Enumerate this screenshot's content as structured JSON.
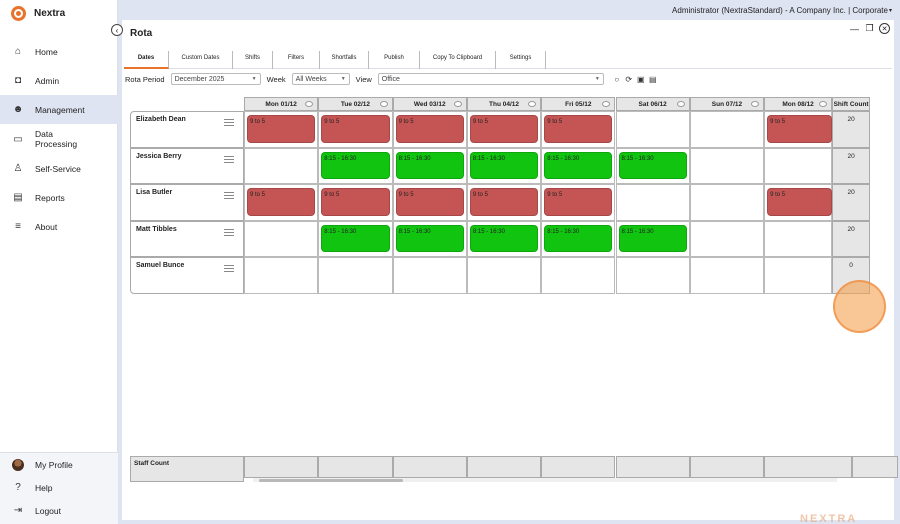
{
  "brand": {
    "name": "Nextra"
  },
  "topbar": {
    "user_text": "Administrator (NextraStandard) - A Company Inc. | Corporate"
  },
  "sidebar": {
    "items": [
      {
        "label": "Home",
        "icon": "home-icon",
        "glyph": "⌂"
      },
      {
        "label": "Admin",
        "icon": "camera-icon",
        "glyph": "◘"
      },
      {
        "label": "Management",
        "icon": "people-icon",
        "glyph": "☻"
      },
      {
        "label": "Data Processing",
        "icon": "folder-icon",
        "glyph": "▭"
      },
      {
        "label": "Self-Service",
        "icon": "person-icon",
        "glyph": "♙"
      },
      {
        "label": "Reports",
        "icon": "report-icon",
        "glyph": "▤"
      },
      {
        "label": "About",
        "icon": "menu-icon",
        "glyph": "≡"
      }
    ],
    "footer": [
      {
        "label": "My Profile",
        "icon": "avatar"
      },
      {
        "label": "Help",
        "icon": "help-icon",
        "glyph": "?"
      },
      {
        "label": "Logout",
        "icon": "logout-icon",
        "glyph": "⇥"
      }
    ]
  },
  "main": {
    "title": "Rota"
  },
  "tabs": [
    "Dates",
    "Custom Dates",
    "Shifts",
    "Filters",
    "Shortfalls",
    "Publish",
    "Copy To Clipboard",
    "Settings"
  ],
  "filters": {
    "rota_period_label": "Rota Period",
    "rota_period_value": "December 2025",
    "week_label": "Week",
    "week_value": "All Weeks",
    "view_label": "View",
    "view_value": "Office"
  },
  "grid": {
    "days": [
      "Mon 01/12",
      "Tue 02/12",
      "Wed 03/12",
      "Thu 04/12",
      "Fri 05/12",
      "Sat 06/12",
      "Sun 07/12",
      "Mon 08/12"
    ],
    "count_header": "Shift Count",
    "rows": [
      {
        "name": "Elizabeth Dean",
        "count": "20",
        "shifts": [
          "9 to 5",
          "9 to 5",
          "9 to 5",
          "9 to 5",
          "9 to 5",
          "",
          "",
          "9 to 5"
        ]
      },
      {
        "name": "Jessica Berry",
        "count": "20",
        "shifts": [
          "",
          "8:15 - 16:30",
          "8:15 - 16:30",
          "8:15 - 16:30",
          "8:15 - 16:30",
          "8:15 - 16:30",
          "",
          ""
        ]
      },
      {
        "name": "Lisa Butler",
        "count": "20",
        "shifts": [
          "9 to 5",
          "9 to 5",
          "9 to 5",
          "9 to 5",
          "9 to 5",
          "",
          "",
          "9 to 5"
        ]
      },
      {
        "name": "Matt Tibbles",
        "count": "20",
        "shifts": [
          "",
          "8:15 - 16:30",
          "8:15 - 16:30",
          "8:15 - 16:30",
          "8:15 - 16:30",
          "8:15 - 16:30",
          "",
          ""
        ]
      },
      {
        "name": "Samuel Bunce",
        "count": "0",
        "shifts": [
          "",
          "",
          "",
          "",
          "",
          "",
          "",
          ""
        ]
      }
    ],
    "staff_count_label": "Staff Count"
  },
  "colors": {
    "accent": "#e8732a",
    "shift_red": "#c55555",
    "shift_green": "#10c410",
    "active_nav": "#dfe4f2"
  },
  "watermark": "NEXTRA"
}
